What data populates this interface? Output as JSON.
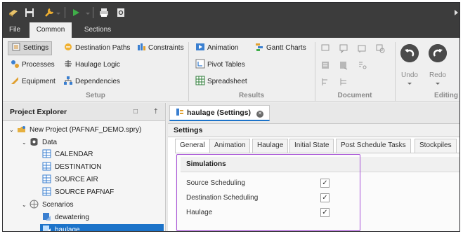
{
  "menu_tabs": [
    {
      "label": "File"
    },
    {
      "label": "Common"
    },
    {
      "label": "Sections"
    }
  ],
  "ribbon": {
    "setup": {
      "group_label": "Setup",
      "buttons": [
        "Settings",
        "Processes",
        "Equipment",
        "Destination Paths",
        "Haulage Logic",
        "Dependencies",
        "Constraints"
      ]
    },
    "results": {
      "group_label": "Results",
      "buttons": [
        "Animation",
        "Pivot Tables",
        "Spreadsheet",
        "Gantt Charts"
      ]
    },
    "document": {
      "group_label": "Document"
    },
    "editing": {
      "group_label": "Editing",
      "undo": "Undo",
      "redo": "Redo"
    }
  },
  "explorer": {
    "title": "Project Explorer",
    "pin_glyph": "□",
    "close_glyph": "†",
    "project": "New Project (PAFNAF_DEMO.spry)",
    "data_label": "Data",
    "data_items": [
      "CALENDAR",
      "DESTINATION",
      "SOURCE AIR",
      "SOURCE PAFNAF"
    ],
    "scenarios_label": "Scenarios",
    "scenario_items": [
      "dewatering",
      "haulage"
    ]
  },
  "document": {
    "tab_title": "haulage (Settings)",
    "section_title": "Settings",
    "tabs": [
      "General",
      "Animation",
      "Haulage",
      "Initial State",
      "Post Schedule Tasks",
      "Stockpiles"
    ],
    "active_tab": "General",
    "simulations": {
      "title": "Simulations",
      "options": [
        {
          "label": "Source Scheduling",
          "checked": true
        },
        {
          "label": "Destination Scheduling",
          "checked": true
        },
        {
          "label": "Haulage",
          "checked": true
        }
      ]
    }
  },
  "colors": {
    "title_bar": "#3c3c3c",
    "selection": "#1c73c9",
    "highlight_box": "#a64fd6"
  }
}
